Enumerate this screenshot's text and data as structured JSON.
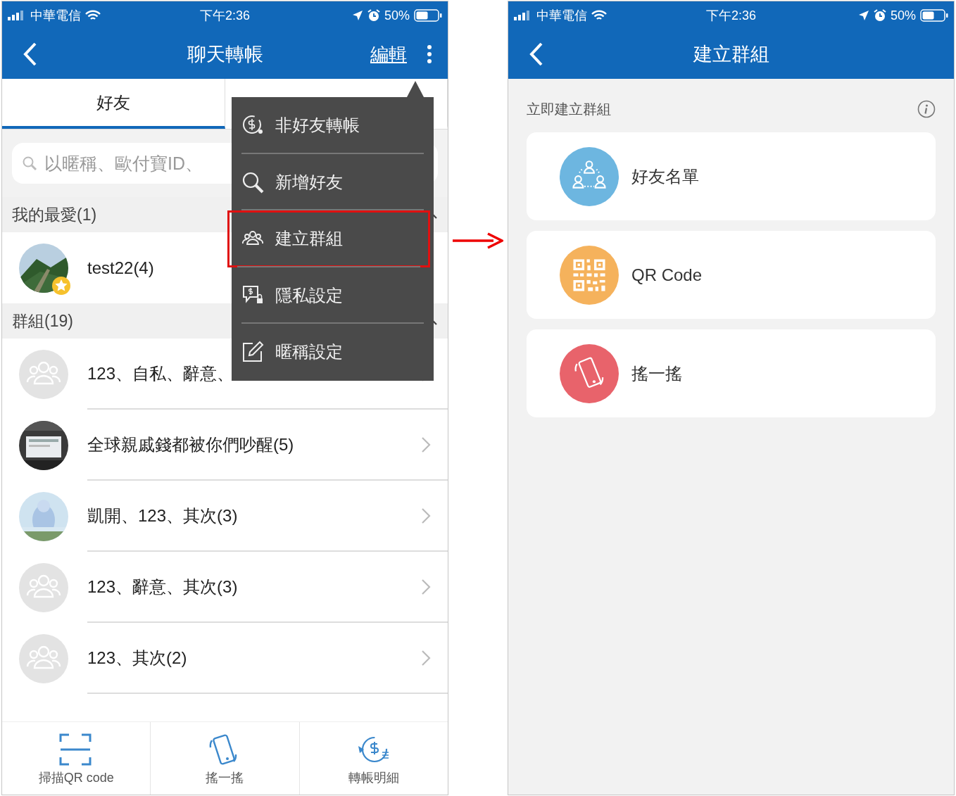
{
  "left": {
    "status_bar": {
      "carrier": "中華電信",
      "time": "下午2:36",
      "battery": "50%"
    },
    "nav": {
      "title": "聊天轉帳",
      "action": "編輯"
    },
    "tabs": [
      {
        "label": "好友",
        "selected": true
      },
      {
        "selected": false
      }
    ],
    "search": {
      "placeholder": "以暱稱、歐付寶ID、"
    },
    "sections": [
      {
        "title": "我的最愛(1)",
        "rows": [
          {
            "name": "test22(4)",
            "kind": "picture",
            "favorite": true
          }
        ]
      },
      {
        "title": "群組(19)",
        "rows": [
          {
            "name": "123、自私、辭意、",
            "kind": "group",
            "favorite": false
          },
          {
            "name": "全球親戚錢都被你們吵醒(5)",
            "kind": "picture",
            "favorite": false
          },
          {
            "name": "凱開、123、其次(3)",
            "kind": "picture",
            "favorite": false
          },
          {
            "name": "123、辭意、其次(3)",
            "kind": "group",
            "favorite": false
          },
          {
            "name": "123、其次(2)",
            "kind": "group",
            "favorite": false
          }
        ]
      }
    ],
    "menu": [
      {
        "kind": "transfer",
        "label": "非好友轉帳",
        "highlighted": false
      },
      {
        "kind": "search",
        "label": "新增好友",
        "highlighted": false
      },
      {
        "kind": "group",
        "label": "建立群組",
        "highlighted": true
      },
      {
        "kind": "privacy",
        "label": "隱私設定",
        "highlighted": false
      },
      {
        "kind": "edit",
        "label": "暱稱設定",
        "highlighted": false
      }
    ],
    "toolbar": [
      {
        "kind": "scan",
        "label": "掃描QR code"
      },
      {
        "kind": "shake",
        "label": "搖一搖"
      },
      {
        "kind": "transfer",
        "label": "轉帳明細"
      }
    ]
  },
  "right": {
    "status_bar": {
      "carrier": "中華電信",
      "time": "下午2:36",
      "battery": "50%"
    },
    "nav": {
      "title": "建立群組"
    },
    "section_title": "立即建立群組",
    "options": [
      {
        "kind": "friends",
        "label": "好友名單",
        "color": "#6db6e0"
      },
      {
        "kind": "qr",
        "label": "QR Code",
        "color": "#f5b25c"
      },
      {
        "kind": "shake",
        "label": "搖一搖",
        "color": "#e8636b"
      }
    ]
  }
}
